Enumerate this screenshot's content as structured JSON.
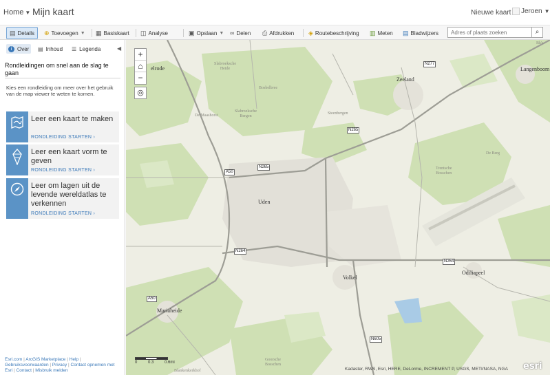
{
  "header": {
    "home_label": "Home",
    "app_title": "Mijn kaart",
    "new_map_label": "Nieuwe kaart",
    "user_name": "Jeroen"
  },
  "toolbar": {
    "details_label": "Details",
    "add_label": "Toevoegen",
    "basemap_label": "Basiskaart",
    "analysis_label": "Analyse",
    "save_label": "Opslaan",
    "share_label": "Delen",
    "print_label": "Afdrukken",
    "directions_label": "Routebeschrijving",
    "measure_label": "Meten",
    "bookmarks_label": "Bladwijzers",
    "search_placeholder": "Adres of plaats zoeken"
  },
  "sidebar": {
    "tabs": {
      "about": "Over",
      "content": "Inhoud",
      "legend": "Legenda"
    },
    "intro_title": "Rondleidingen om snel aan de slag te gaan",
    "intro_text": "Kies een rondleiding om meer over het gebruik van de map viewer te weten te komen.",
    "tours": [
      {
        "title": "Leer een kaart te maken",
        "link": "RONDLEIDING STARTEN ›",
        "icon": "map-icon"
      },
      {
        "title": "Leer een kaart vorm te geven",
        "link": "RONDLEIDING STARTEN ›",
        "icon": "style-icon"
      },
      {
        "title": "Leer om lagen uit de levende wereldatlas te verkennen",
        "link": "RONDLEIDING STARTEN ›",
        "icon": "compass-icon"
      }
    ],
    "footer": {
      "esri": "Esri.com",
      "marketplace": "ArcGIS Marketplace",
      "help": "Help",
      "terms": "Gebruiksvoorwaarden",
      "privacy": "Privacy",
      "contact_esri": "Contact opnemen met Esri",
      "contact": "Contact",
      "report_abuse": "Misbruik melden"
    }
  },
  "map": {
    "towns": {
      "uden": "Uden",
      "zeeland": "Zeeland",
      "volkel": "Volkel",
      "odiliapeel": "Odiliapeel",
      "mariaheide": "Mariaheide",
      "langenboom": "Langenboom",
      "zelrode": "elrode"
    },
    "places": {
      "slabroek_heide": "Slabroeksche\nHeide",
      "bosbelbree": "Bosbelbree",
      "de_maashorst": "De Maashorst",
      "slabroek_bergen": "Slabroeksche\nBergen",
      "steenbergen": "Steenbergen",
      "de_berg": "De Berg",
      "trentsche_bosschen": "Trentsche\nBosschen",
      "goorsche_bosschen": "Goorsche\nBosschen",
      "blankenkerkhof": "Blankenkerkhof",
      "bks": "Bk's"
    },
    "shields": {
      "n277": "N277",
      "n265a": "N265",
      "n265b": "N265",
      "a50a": "A50",
      "n264a": "N264",
      "n264b": "N264",
      "a50b": "A50",
      "n605": "N605"
    },
    "scale_labels": [
      "0",
      "0.3",
      "0.6mi"
    ],
    "attribution": "Kadaster, RWS, Esri, HERE, DeLorme, INCREMENT P, USGS, METI/NASA, NGA",
    "logo_text": "esri"
  },
  "colors": {
    "accent": "#3a78b8",
    "tile": "#5b93c6",
    "map_bg": "#eeeee4",
    "green": "#cfe0b4"
  }
}
